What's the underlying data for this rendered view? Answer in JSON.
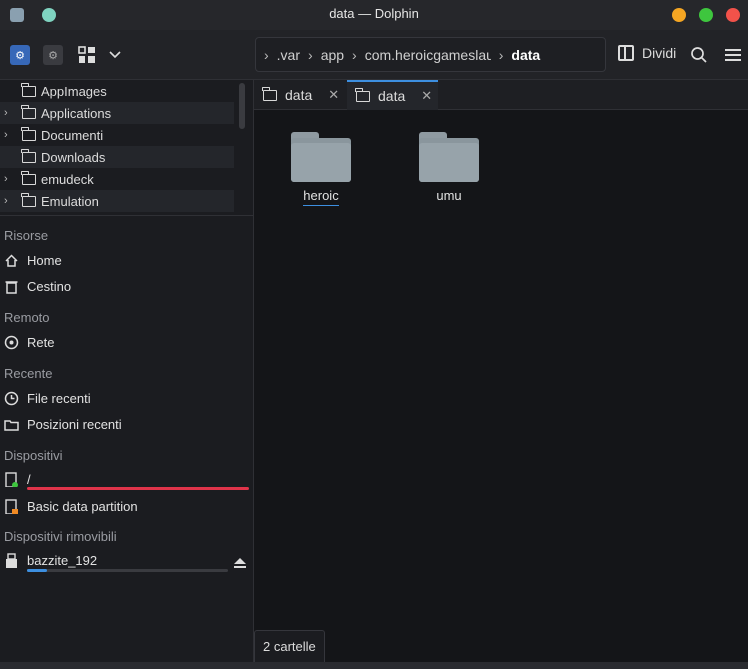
{
  "window": {
    "title": "data — Dolphin"
  },
  "toolbar": {
    "breadcrumb": [
      ".var",
      "app",
      "com.heroicgameslau",
      "data"
    ],
    "split_label": "Dividi"
  },
  "tree": {
    "items": [
      {
        "label": "AppImages",
        "expandable": false
      },
      {
        "label": "Applications",
        "expandable": true
      },
      {
        "label": "Documenti",
        "expandable": true
      },
      {
        "label": "Downloads",
        "expandable": false
      },
      {
        "label": "emudeck",
        "expandable": true
      },
      {
        "label": "Emulation",
        "expandable": true
      }
    ]
  },
  "places": {
    "risorse": "Risorse",
    "home": "Home",
    "cestino": "Cestino",
    "remoto": "Remoto",
    "rete": "Rete",
    "recente": "Recente",
    "file_recenti": "File recenti",
    "posizioni_recenti": "Posizioni recenti",
    "dispositivi": "Dispositivi",
    "root": "/",
    "root_usage": 1.0,
    "basic_partition": "Basic data partition",
    "rimovibili": "Dispositivi rimovibili",
    "bazzite": "bazzite_192",
    "bazzite_usage": 0.1
  },
  "tabs": [
    {
      "label": "data",
      "active": false
    },
    {
      "label": "data",
      "active": true
    }
  ],
  "content": {
    "items": [
      {
        "label": "heroic",
        "selected": true
      },
      {
        "label": "umu",
        "selected": false
      }
    ]
  },
  "status": {
    "text": "2 cartelle"
  },
  "colors": {
    "accent": "#3d8fe0",
    "danger": "#e0344a",
    "min": "#f5a623",
    "max": "#3ec63e",
    "close": "#f2524a"
  }
}
